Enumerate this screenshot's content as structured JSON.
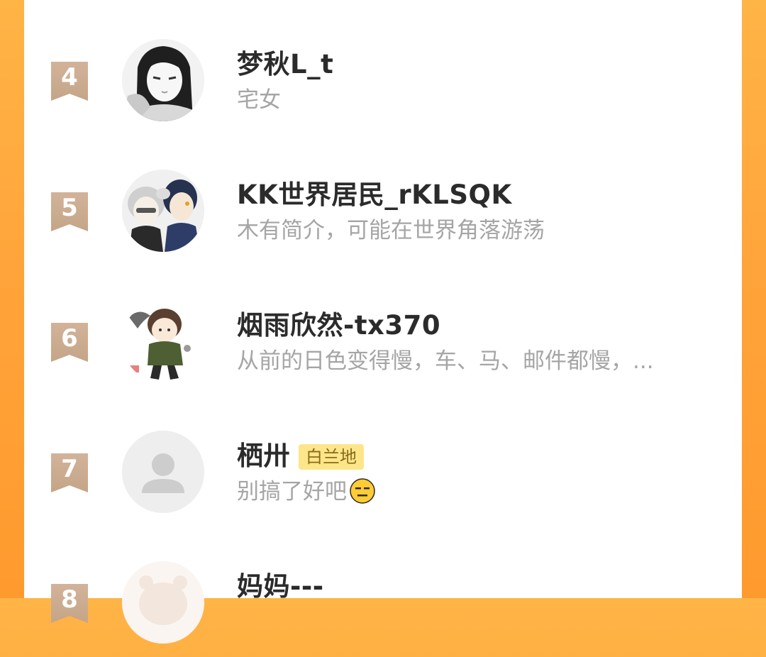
{
  "ranking": [
    {
      "rank": "4",
      "name": "梦秋L_t",
      "tag": "",
      "bio": "宅女",
      "avatar": "anime-girl-avatar"
    },
    {
      "rank": "5",
      "name": "KK世界居民_rKLSQK",
      "tag": "",
      "bio": "木有简介，可能在世界角落游荡",
      "avatar": "anime-duo-avatar"
    },
    {
      "rank": "6",
      "name": "烟雨欣然-tx370",
      "tag": "",
      "bio": "从前的日色变得慢，车、马、邮件都慢，...",
      "avatar": "chibi-boy-avatar"
    },
    {
      "rank": "7",
      "name": "栖卅",
      "tag": "白兰地",
      "bio": "别搞了好吧",
      "avatar": "default-avatar"
    },
    {
      "rank": "8",
      "name": "妈妈---",
      "tag": "",
      "bio": "",
      "avatar": "cute-bear-avatar"
    }
  ],
  "colors": {
    "background_orange": "#ffa43a",
    "rank_badge": "#c9a98b",
    "tag_bg": "#fde68a",
    "bio_gray": "#a5a5a5"
  }
}
